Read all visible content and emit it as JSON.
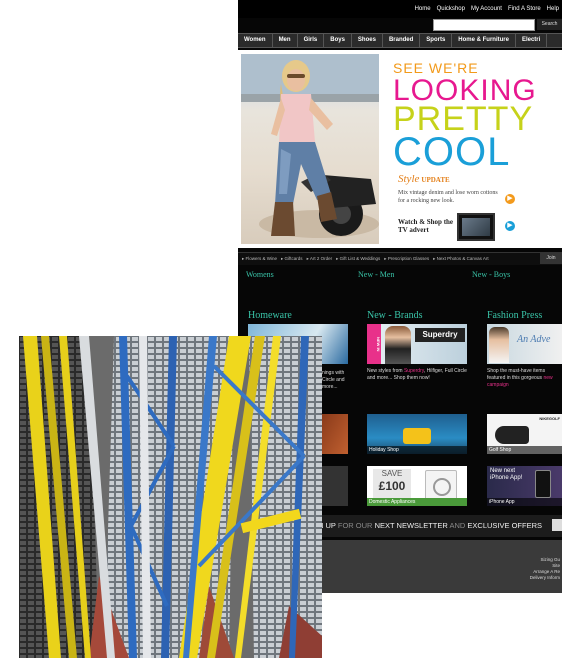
{
  "shop": {
    "top_links": [
      "Home",
      "Quickshop",
      "My Account",
      "Find A Store",
      "Help"
    ],
    "search_button": "Search",
    "nav": [
      "Women",
      "Men",
      "Girls",
      "Boys",
      "Shoes",
      "Branded",
      "Sports",
      "Home & Furniture",
      "Electri"
    ],
    "hero": {
      "line1": "SEE WE'RE",
      "line2": "LOOKING",
      "line3": "PRETTY",
      "line4": "COOL",
      "style_script": "Style",
      "style_update": "UPDATE",
      "style_desc": "Mix vintage denim and lose worn cottons for a rocking new look.",
      "watch_shop": "Watch & Shop the TV advert"
    },
    "subnav": [
      "Flowers & Wine",
      "Giftcards",
      "Art 2 Order",
      "Gift List & Weddings",
      "Prescription Glasses",
      "Next Photos & Canvas Art"
    ],
    "subnav_end": "Join",
    "columns": [
      "Womens",
      "New - Men",
      "New - Boys"
    ],
    "sections": [
      "Homeware",
      "New - Brands",
      "Fashion Press"
    ],
    "tiles": {
      "homeware_text": "nings with Circle and more...",
      "brands_badge": "NEW IN",
      "brands_logo": "Superdry",
      "brands_text_a": "New styles from ",
      "brands_text_link": "Superdry",
      "brands_text_b": ", Hilfiger, Full Circle and more... Shop them now!",
      "press_logo": "An Adve",
      "press_text_a": "Shop the must-have items featured in this gorgeous ",
      "press_text_link": "new campaign",
      "holiday_shop": "Holiday Shop",
      "golf_shop": "Golf Shop",
      "golf_logo": "NIKEGOLF",
      "save_label": "SAVE",
      "save_amount": "£100",
      "domestic": "Domestic Appliances",
      "app_line1": "New next",
      "app_line2": "iPhone App!",
      "app_cap": "iPhone App"
    },
    "newsletter": {
      "sign": "N UP",
      "for_our": "FOR OUR",
      "next_newsletter": "NEXT NEWSLETTER",
      "and": "AND",
      "exclusive": "EXCLUSIVE OFFERS"
    },
    "footer_links": [
      "Sizing Gu",
      "Site",
      "Arrange A Re",
      "Delivery Inform"
    ]
  },
  "colors": {
    "teal_heading": "#39c4a8",
    "orange": "#f29a1a",
    "pink": "#e7188f",
    "lime": "#c6d21a",
    "blue": "#1a9fd8"
  }
}
